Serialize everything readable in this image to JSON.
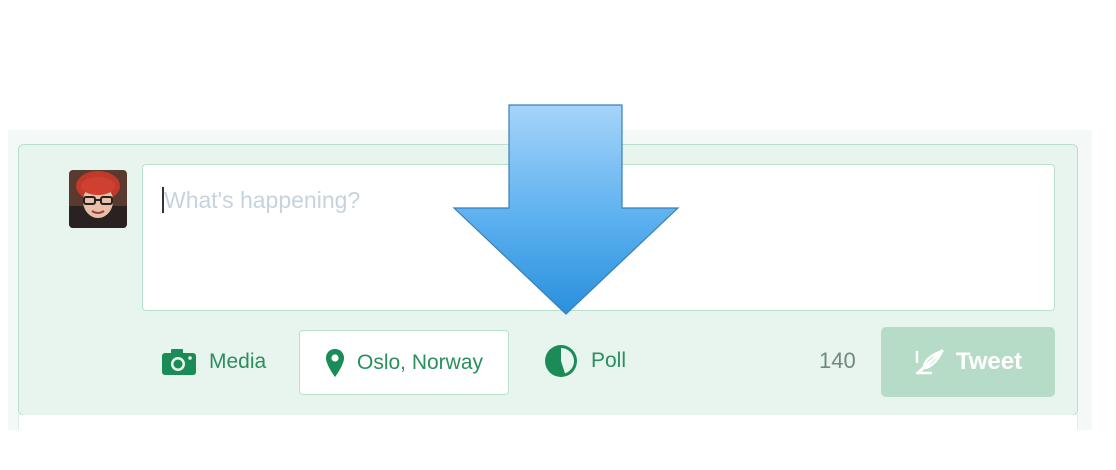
{
  "composer": {
    "placeholder": "What's happening?",
    "char_counter": "140",
    "tweet_label": "Tweet"
  },
  "toolbar": {
    "media_label": "Media",
    "location_label": "Oslo, Norway",
    "poll_label": "Poll"
  },
  "icons": {
    "media": "camera-icon",
    "location": "map-pin-icon",
    "poll": "pie-chart-icon",
    "tweet": "quill-icon",
    "overlay": "down-arrow"
  },
  "colors": {
    "accent_green": "#1b8b57",
    "card_background": "#e8f5ee",
    "card_border": "#b9e0cb",
    "tweet_button_disabled": "#b6dcc8",
    "arrow_blue": "#3a9be0"
  }
}
